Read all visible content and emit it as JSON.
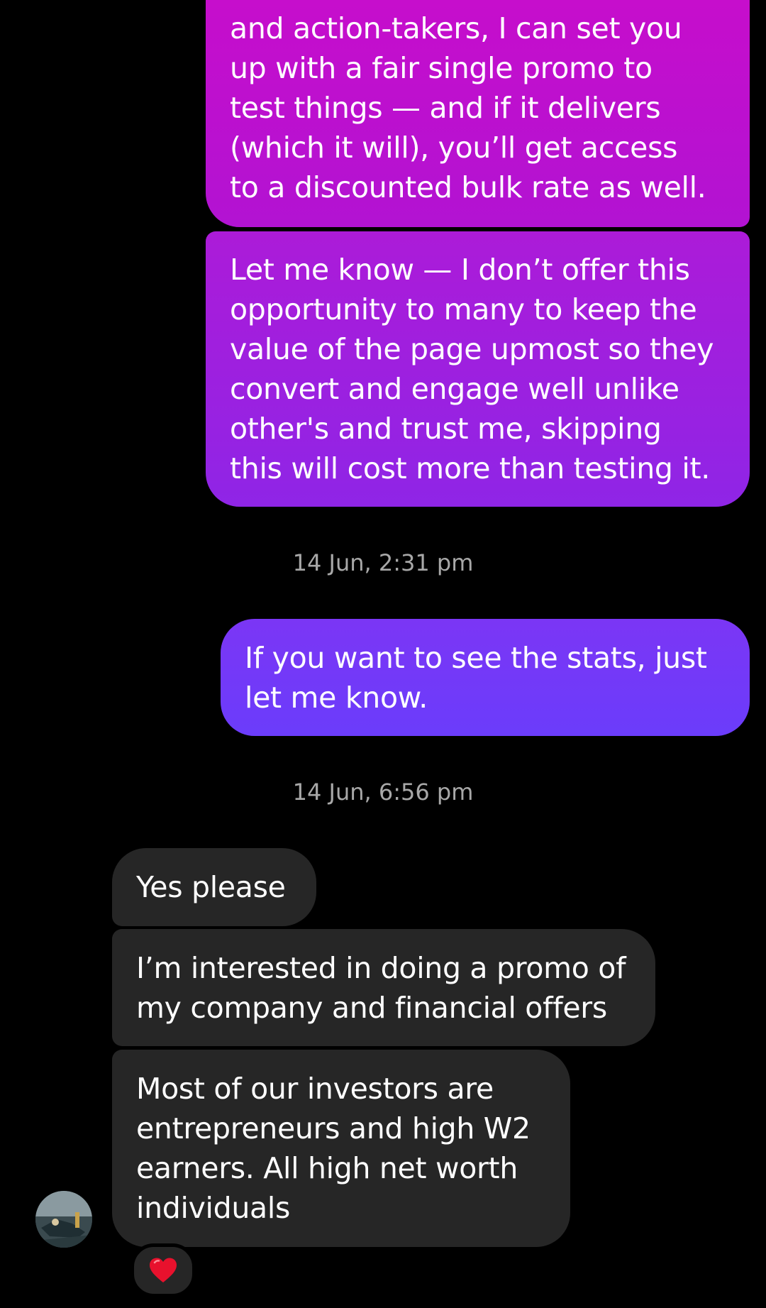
{
  "conversation": {
    "messages_out": [
      {
        "text": "and action-takers, I can set you\nup with a fair single promo to\ntest things — and if it delivers\n(which it will), you’ll get access\nto a discounted bulk rate as well."
      },
      {
        "text": "Let me know — I don’t offer this\nopportunity to many to keep the\nvalue of the page upmost so they\nconvert and engage well unlike\nother's and trust me, skipping\nthis will cost more than testing it."
      },
      {
        "text": "If you want to see the stats, just\nlet me know."
      }
    ],
    "timestamps": [
      "14 Jun, 2:31 pm",
      "14 Jun, 6:56 pm"
    ],
    "messages_in": [
      {
        "text": "Yes please"
      },
      {
        "text": "I’m interested in doing a promo of\nmy company and financial offers"
      },
      {
        "text": "Most of our investors are\nentrepreneurs and high W2\nearners. All high net worth\nindividuals"
      }
    ],
    "reaction": {
      "icon": "red-heart-icon",
      "emoji": "❤"
    }
  },
  "colors": {
    "background": "#000000",
    "incoming_bubble": "#262626",
    "outgoing_gradient_top": "#c80dcb",
    "outgoing_gradient_mid": "#9a22e0",
    "outgoing_gradient_bottom": "#6b3cfb",
    "timestamp_text": "#a8a8a8",
    "heart": "#e8112d"
  }
}
